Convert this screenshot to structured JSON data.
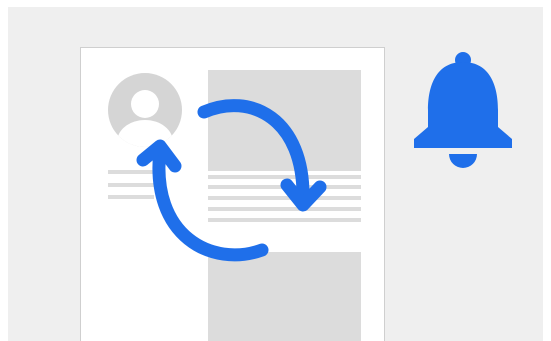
{
  "illustration": {
    "icons": [
      "profile-document-icon",
      "avatar-icon",
      "sync-arrows-icon",
      "bell-icon"
    ]
  },
  "colors": {
    "panel_background": "#efefef",
    "document": "#ffffff",
    "document_border": "#cfcfcf",
    "placeholder_gray": "#dcdcdc",
    "avatar_circle": "#d5d5d5",
    "avatar_figure": "#ffffff",
    "accent_blue": "#1f6fea"
  }
}
